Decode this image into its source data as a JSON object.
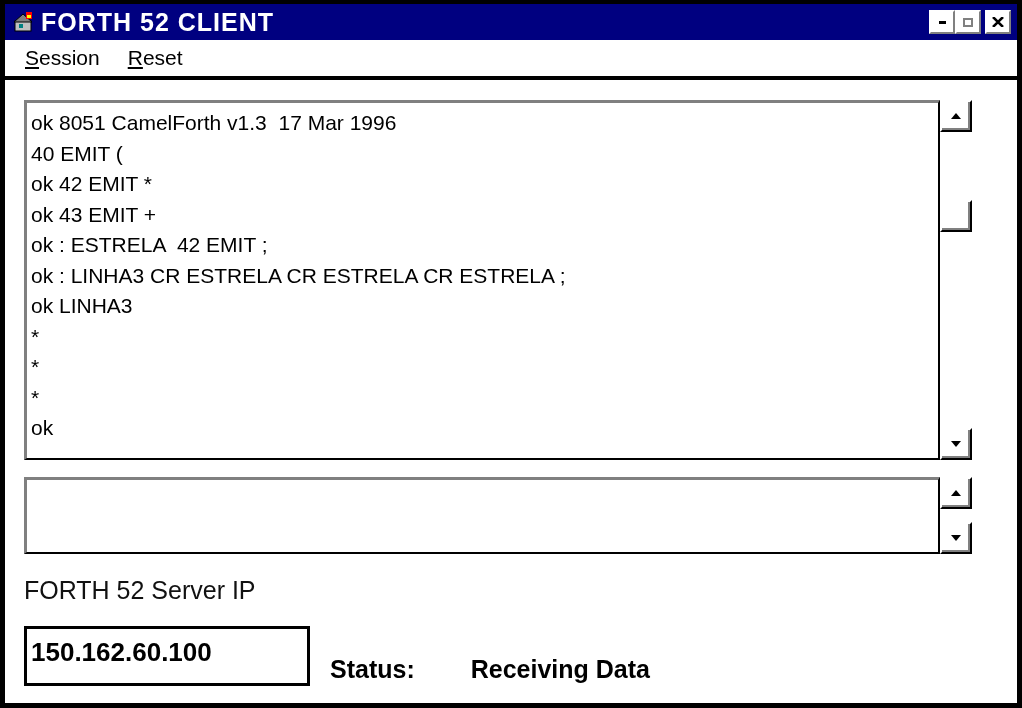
{
  "window": {
    "title": "FORTH 52 CLIENT"
  },
  "menu": [
    {
      "label": "Session"
    },
    {
      "label": "Reset"
    }
  ],
  "console": {
    "lines": [
      "ok 8051 CamelForth v1.3  17 Mar 1996",
      "40 EMIT (",
      "ok 42 EMIT *",
      "ok 43 EMIT +",
      "ok : ESTRELA  42 EMIT ;",
      "ok : LINHA3 CR ESTRELA CR ESTRELA CR ESTRELA ;",
      "ok LINHA3",
      "*",
      "*",
      "*",
      "ok"
    ]
  },
  "server_ip": {
    "label": "FORTH 52 Server IP",
    "value": "150.162.60.100"
  },
  "status": {
    "label": "Status:",
    "value": "Receiving Data"
  }
}
